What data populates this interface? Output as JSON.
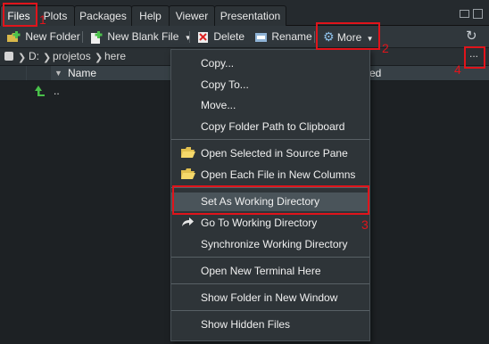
{
  "tabs": [
    {
      "label": "Files",
      "active": true
    },
    {
      "label": "Plots",
      "active": false
    },
    {
      "label": "Packages",
      "active": false
    },
    {
      "label": "Help",
      "active": false
    },
    {
      "label": "Viewer",
      "active": false
    },
    {
      "label": "Presentation",
      "active": false
    }
  ],
  "toolbar": {
    "new_folder": "New Folder",
    "new_blank_file": "New Blank File",
    "delete": "Delete",
    "rename": "Rename",
    "more": "More"
  },
  "path": {
    "crumbs": [
      "D:",
      "projetos",
      "here"
    ],
    "more_button": "..."
  },
  "table": {
    "name_header": "Name",
    "modified_header_fragment": "ed",
    "rows": [
      {
        "name": ".."
      }
    ]
  },
  "menu": {
    "items": [
      {
        "label": "Copy...",
        "icon": null
      },
      {
        "label": "Copy To...",
        "icon": null
      },
      {
        "label": "Move...",
        "icon": null
      },
      {
        "label": "Copy Folder Path to Clipboard",
        "icon": null
      },
      {
        "label": "Open Selected in Source Pane",
        "icon": "open-folder-icon"
      },
      {
        "label": "Open Each File in New Columns",
        "icon": "open-folder-icon"
      },
      {
        "label": "Set As Working Directory",
        "icon": null,
        "highlighted": true
      },
      {
        "label": "Go To Working Directory",
        "icon": "goto-arrow-icon"
      },
      {
        "label": "Synchronize Working Directory",
        "icon": null
      },
      {
        "label": "Open New Terminal Here",
        "icon": null
      },
      {
        "label": "Show Folder in New Window",
        "icon": null
      },
      {
        "label": "Show Hidden Files",
        "icon": null
      }
    ]
  },
  "annotations": [
    {
      "number": "1",
      "target": "Files tab"
    },
    {
      "number": "2",
      "target": "More button"
    },
    {
      "number": "3",
      "target": "Set As Working Directory"
    },
    {
      "number": "4",
      "target": "Path ellipsis button"
    }
  ],
  "colors": {
    "annotation_red": "#e0141b",
    "background": "#1d2124",
    "menu_background": "#2e3438",
    "menu_highlight": "#4a545a"
  }
}
